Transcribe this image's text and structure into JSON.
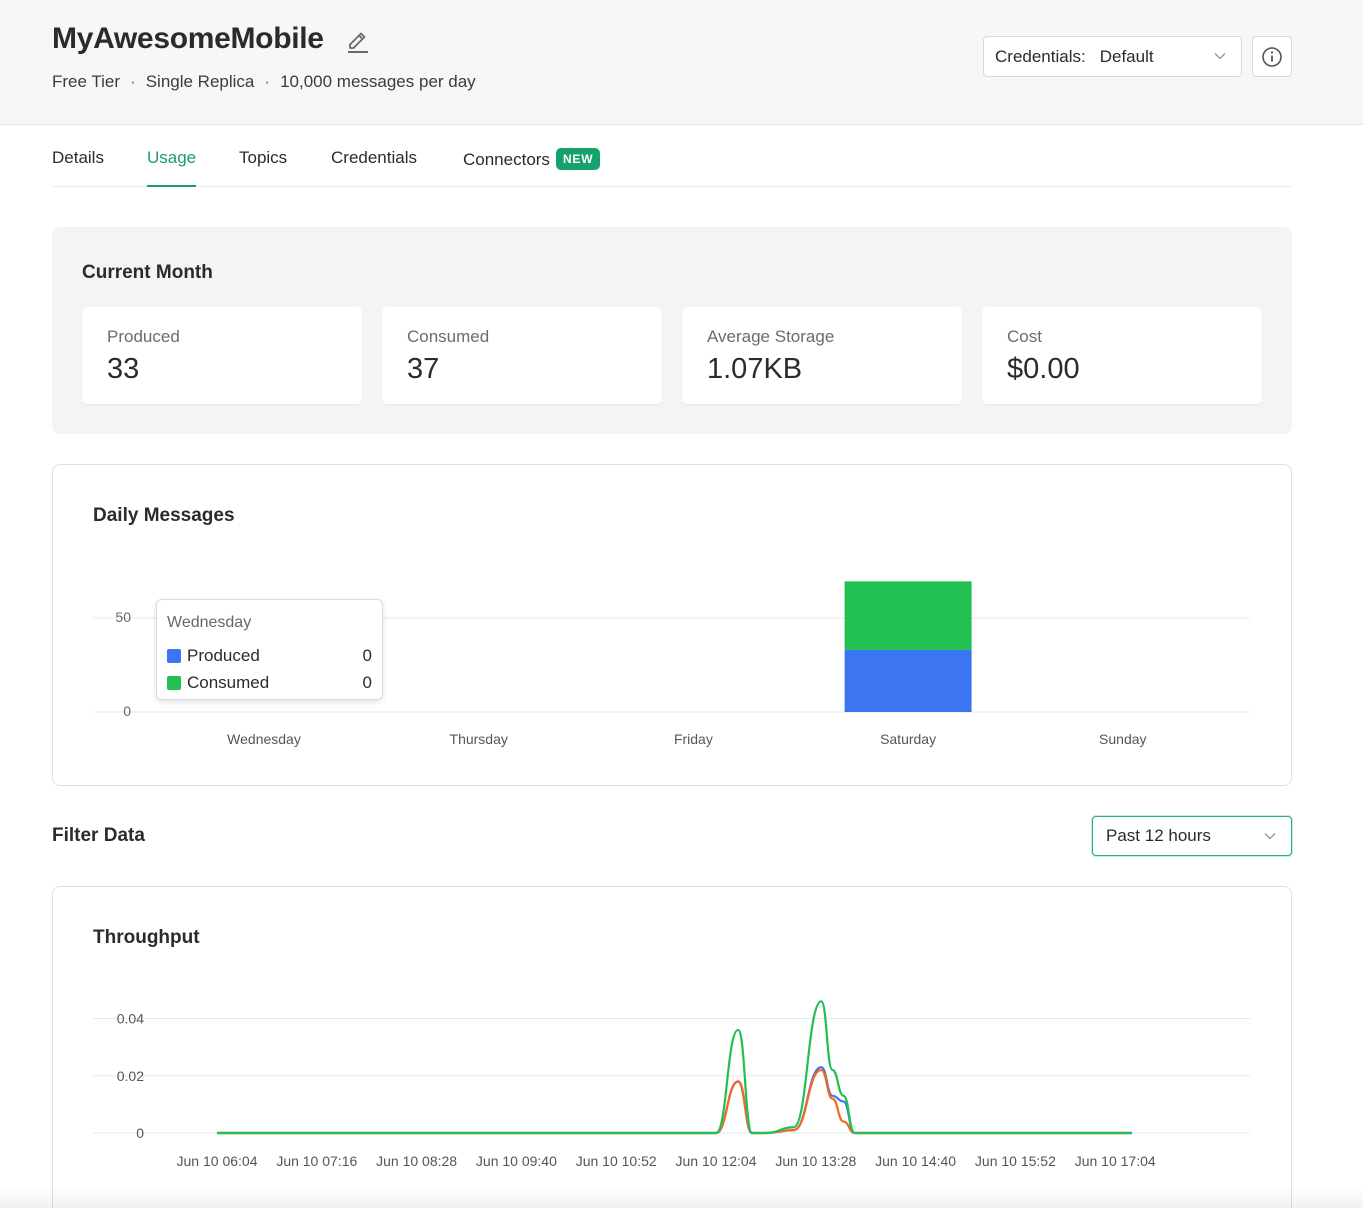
{
  "header": {
    "title": "MyAwesomeMobile",
    "tier": "Free Tier",
    "replica": "Single Replica",
    "limit": "10,000 messages per day",
    "separator": "·",
    "credentials_label": "Credentials:",
    "credentials_value": "Default"
  },
  "tabs": [
    {
      "label": "Details"
    },
    {
      "label": "Usage"
    },
    {
      "label": "Topics"
    },
    {
      "label": "Credentials"
    },
    {
      "label": "Connectors",
      "badge": "NEW"
    }
  ],
  "current_month": {
    "title": "Current Month",
    "stats": [
      {
        "label": "Produced",
        "value": "33"
      },
      {
        "label": "Consumed",
        "value": "37"
      },
      {
        "label": "Average Storage",
        "value": "1.07KB"
      },
      {
        "label": "Cost",
        "value": "$0.00"
      }
    ]
  },
  "daily_messages": {
    "title": "Daily Messages",
    "tooltip": {
      "title": "Wednesday",
      "rows": [
        {
          "label": "Produced",
          "value": "0"
        },
        {
          "label": "Consumed",
          "value": "0"
        }
      ]
    }
  },
  "filter": {
    "title": "Filter Data",
    "range_value": "Past 12 hours"
  },
  "throughput": {
    "title": "Throughput"
  },
  "colors": {
    "accent": "#1a9e68",
    "produced": "#3b75f0",
    "consumed": "#22bf52",
    "throughput_orange": "#f06a24"
  },
  "chart_data": [
    {
      "type": "bar",
      "stacked": true,
      "title": "Daily Messages",
      "categories": [
        "Wednesday",
        "Thursday",
        "Friday",
        "Saturday",
        "Sunday"
      ],
      "series": [
        {
          "name": "Produced",
          "values": [
            0,
            0,
            0,
            33,
            0
          ]
        },
        {
          "name": "Consumed",
          "values": [
            0,
            0,
            0,
            37,
            0
          ]
        }
      ],
      "yticks": [
        0,
        50
      ],
      "ylim": [
        0,
        100
      ],
      "grid": true
    },
    {
      "type": "line",
      "title": "Throughput",
      "xticks": [
        "Jun 10 06:04",
        "Jun 10 07:16",
        "Jun 10 08:28",
        "Jun 10 09:40",
        "Jun 10 10:52",
        "Jun 10 12:04",
        "Jun 10 13:28",
        "Jun 10 14:40",
        "Jun 10 15:52",
        "Jun 10 17:04"
      ],
      "yticks": [
        0,
        0.02,
        0.04
      ],
      "ylim": [
        0,
        0.05
      ],
      "grid": true,
      "x": [
        "Jun 10 06:04",
        "Jun 10 12:04",
        "Jun 10 12:20",
        "Jun 10 12:30",
        "Jun 10 12:40",
        "Jun 10 13:00",
        "Jun 10 13:20",
        "Jun 10 13:28",
        "Jun 10 13:36",
        "Jun 10 13:44",
        "Jun 10 14:00",
        "Jun 10 17:04"
      ],
      "series": [
        {
          "values": [
            0,
            0,
            0.018,
            0,
            0,
            0.001,
            0.023,
            0.013,
            0.011,
            0,
            0,
            0
          ]
        },
        {
          "values": [
            0,
            0,
            0.018,
            0,
            0,
            0.001,
            0.022,
            0.012,
            0.004,
            0,
            0,
            0
          ]
        },
        {
          "values": [
            0,
            0,
            0.036,
            0,
            0,
            0.002,
            0.046,
            0.022,
            0.013,
            0,
            0,
            0
          ]
        }
      ]
    }
  ]
}
